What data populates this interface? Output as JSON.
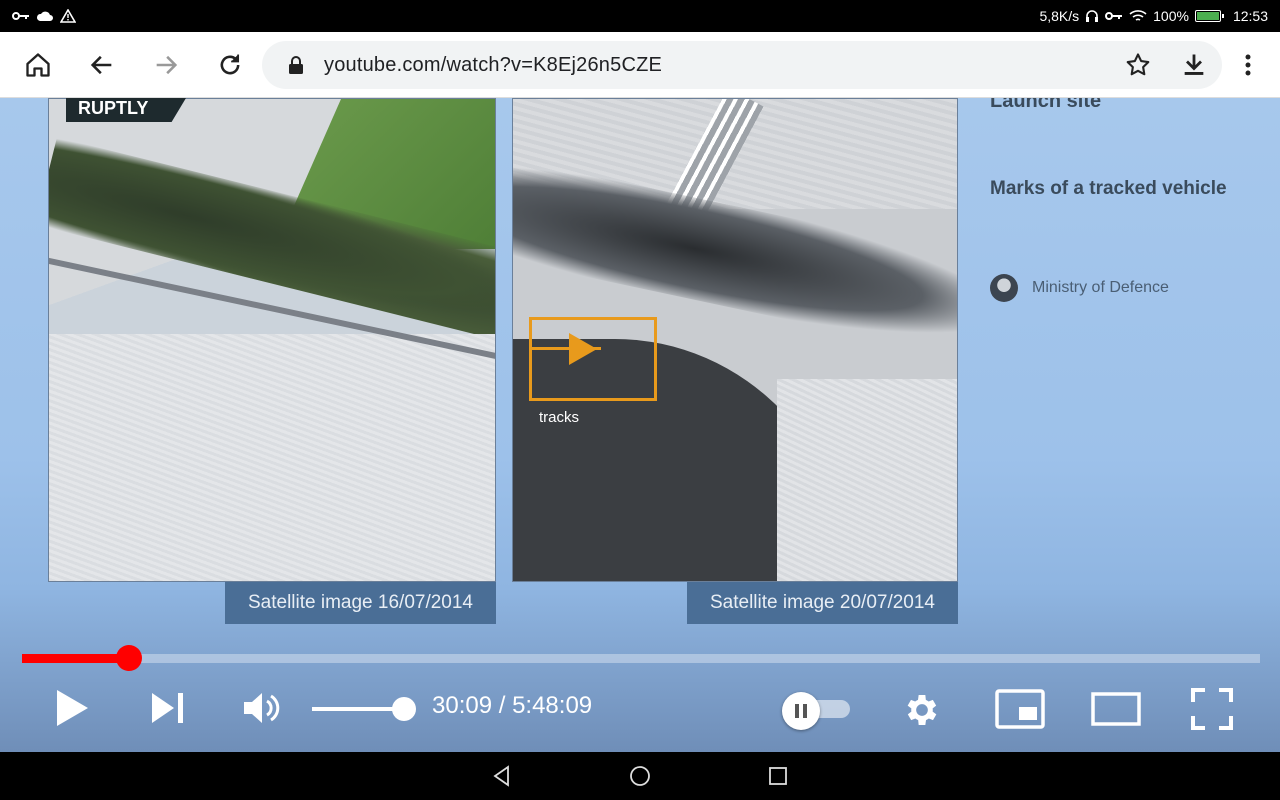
{
  "status_bar": {
    "net_speed": "5,8K/s",
    "battery_pct": "100%",
    "time": "12:53",
    "battery_level": 1.0
  },
  "browser": {
    "url": "youtube.com/watch?v=K8Ej26n5CZE"
  },
  "video": {
    "watermark": "RUPTLY",
    "side_title": "Launch site",
    "side_subtitle": "Marks of a tracked vehicle",
    "source": "Ministry of Defence",
    "tracks_label": "tracks",
    "caption_left": "Satellite image 16/07/2014",
    "caption_right": "Satellite image 20/07/2014",
    "accent_color": "#e89a1c"
  },
  "player": {
    "time_display": "30:09 / 5:48:09",
    "progress_fraction": 0.0868,
    "volume_fraction": 1.0,
    "progress_color": "#ff0000"
  },
  "icons": {
    "home": "home-icon",
    "back": "arrow-left-icon",
    "forward": "arrow-right-icon",
    "reload": "reload-icon",
    "lock": "lock-icon",
    "star": "star-icon",
    "download": "download-icon",
    "menu": "more-vert-icon"
  }
}
